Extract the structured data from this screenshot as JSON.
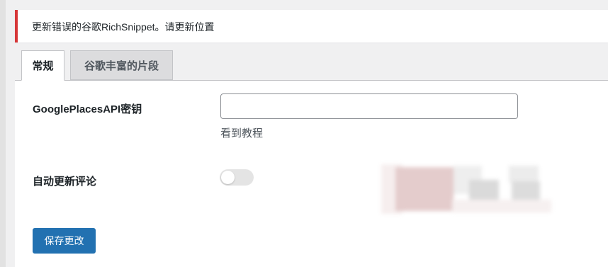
{
  "notice": {
    "text": "更新错误的谷歌RichSnippet。请更新位置",
    "accent_color": "#d63638"
  },
  "tabs": [
    {
      "label": "常规",
      "active": true
    },
    {
      "label": "谷歌丰富的片段",
      "active": false
    }
  ],
  "form": {
    "api_key": {
      "label": "GooglePlacesAPI密钥",
      "value": "",
      "placeholder": "",
      "help_link": "看到教程"
    },
    "auto_update_reviews": {
      "label": "自动更新评论",
      "enabled": false
    },
    "save_label": "保存更改"
  },
  "colors": {
    "primary_button": "#2271b1",
    "toggle_off": "#e4e4e4"
  }
}
